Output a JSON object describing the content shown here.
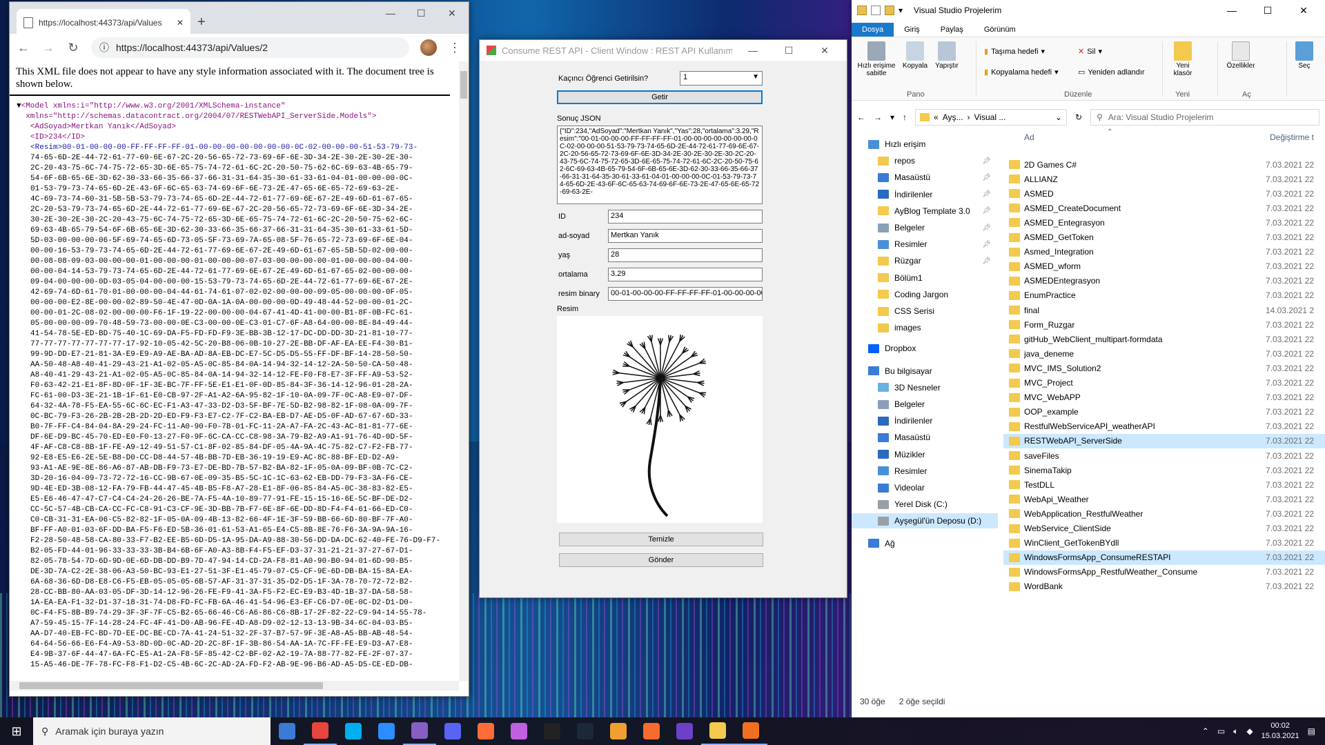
{
  "chrome": {
    "tab_title": "https://localhost:44373/api/Values",
    "url": "https://localhost:44373/api/Values/2",
    "xml_note": "This XML file does not appear to have any style information associated with it. The document tree is shown below.",
    "model_open_1": "<Model xmlns:i=\"http://www.w3.org/2001/XMLSchema-instance\"",
    "model_open_2": "xmlns=\"http://schemas.datacontract.org/2004/07/RESTWebAPI_ServerSide.Models\">",
    "adsoyad_line": "<AdSoyad>Mertkan Yanık</AdSoyad>",
    "id_line": "<ID>234</ID>",
    "resim_lines": [
      "<Resim>00-01-00-00-00-FF-FF-FF-FF-01-00-00-00-00-00-00-00-0C-02-00-00-00-51-53-79-73-",
      "74-65-6D-2E-44-72-61-77-69-6E-67-2C-20-56-65-72-73-69-6F-6E-3D-34-2E-30-2E-30-2E-30-",
      "2C-20-43-75-6C-74-75-72-65-3D-6E-65-75-74-72-61-6C-2C-20-50-75-62-6C-69-63-4B-65-79-",
      "54-6F-6B-65-6E-3D-62-30-33-66-35-66-37-66-31-31-64-35-30-61-33-61-04-01-00-00-00-0C-",
      "01-53-79-73-74-65-6D-2E-43-6F-6C-65-63-74-69-6F-6E-73-2E-47-65-6E-65-72-69-63-2E-",
      "4C-69-73-74-60-31-5B-5B-53-79-73-74-65-6D-2E-44-72-61-77-69-6E-67-2E-49-6D-61-67-65-",
      "2C-20-53-79-73-74-65-6D-2E-44-72-61-77-69-6E-67-2C-20-56-65-72-73-69-6F-6E-3D-34-2E-",
      "30-2E-30-2E-30-2C-20-43-75-6C-74-75-72-65-3D-6E-65-75-74-72-61-6C-2C-20-50-75-62-6C-",
      "69-63-4B-65-79-54-6F-6B-65-6E-3D-62-30-33-66-35-66-37-66-31-31-64-35-30-61-33-61-5D-",
      "5D-03-00-00-00-06-5F-69-74-65-6D-73-05-5F-73-69-7A-65-08-5F-76-65-72-73-69-6F-6E-04-",
      "00-00-16-53-79-73-74-65-6D-2E-44-72-61-77-69-6E-67-2E-49-6D-61-67-65-5B-5D-02-00-00-",
      "00-08-08-09-03-00-00-00-01-00-00-00-01-00-00-00-07-03-00-00-00-00-01-00-00-00-04-00-",
      "00-00-04-14-53-79-73-74-65-6D-2E-44-72-61-77-69-6E-67-2E-49-6D-61-67-65-02-00-00-00-",
      "09-04-00-00-00-0D-03-05-04-00-00-00-15-53-79-73-74-65-6D-2E-44-72-61-77-69-6E-67-2E-",
      "42-69-74-6D-61-70-01-00-00-00-04-44-61-74-61-07-02-02-00-00-00-09-05-00-00-00-0F-05-",
      "00-00-00-E2-8E-00-00-02-89-50-4E-47-0D-0A-1A-0A-00-00-00-0D-49-48-44-52-00-00-01-2C-",
      "00-00-01-2C-08-02-00-00-00-F6-1F-19-22-00-00-00-04-67-41-4D-41-00-00-B1-8F-0B-FC-61-",
      "05-00-00-00-09-70-48-59-73-00-00-0E-C3-00-00-0E-C3-01-C7-6F-A8-64-00-00-8E-84-49-44-",
      "41-54-78-5E-ED-BD-75-40-1C-69-DA-F5-FD-FD-F9-3E-BB-3B-12-17-DC-DD-DD-3D-21-81-10-77-",
      "77-77-77-77-77-77-77-17-92-10-05-42-5C-20-B8-06-0B-10-27-2E-BB-DF-AF-EA-EE-F4-30-B1-",
      "99-9D-DD-E7-21-81-3A-E9-E9-A9-AE-BA-AD-8A-EB-DC-E7-5C-D5-D5-55-FF-DF-BF-14-28-50-50-",
      "AA-50-48-A8-40-41-29-43-21-A1-02-05-A5-0C-85-84-0A-14-94-32-14-12-2A-50-50-CA-50-48-",
      "A8-40-41-29-43-21-A1-02-05-A5-0C-85-84-0A-14-94-32-14-12-FE-F0-F8-E7-3F-FF-A9-53-52-",
      "F0-63-42-21-E1-8F-8D-0F-1F-3E-BC-7F-FF-5E-E1-E1-0F-0D-85-84-3F-36-14-12-96-01-28-2A-",
      "FC-61-00-D3-3E-21-1B-1F-61-E0-CB-97-2F-A1-A2-6A-95-82-1F-10-0A-09-7F-0C-A8-E9-07-DF-",
      "64-32-4A-78-F5-EA-55-6C-6C-EC-F1-A3-47-33-D2-D3-5F-BF-7E-5D-B2-98-82-1F-08-0A-09-7F-",
      "0C-BC-79-F3-26-2B-2B-2B-2D-2D-ED-F9-F3-E7-C2-7F-C2-BA-EB-D7-AE-D5-0F-AD-67-67-6D-33-",
      "B0-7F-FF-C4-84-04-8A-29-24-FC-11-A0-90-F0-7B-01-FC-11-2A-A7-FA-2C-43-AC-81-81-77-6E-",
      "DF-6E-D9-BC-45-70-ED-E0-F0-13-27-F0-9F-6C-CA-CC-C8-98-3A-79-B2-A9-A1-91-76-4D-0D-5F-",
      "4F-AF-C8-C8-8B-1F-FE-A9-12-49-51-57-C1-8F-02-85-84-DF-05-4A-9A-4C-75-82-C7-F2-FB-77-",
      "92-E8-E5-E6-2E-5E-B8-D0-CC-D8-44-57-4B-BB-7D-EB-36-19-19-E9-AC-8C-88-BF-ED-D2-A9-",
      "93-A1-AE-9E-8E-86-A6-87-AB-DB-F9-73-E7-DE-BD-7B-57-B2-BA-82-1F-05-0A-09-BF-0B-7C-C2-",
      "3D-20-16-04-09-73-72-72-16-CC-9B-67-0E-09-35-B5-5C-1C-1C-63-62-EB-DD-79-F3-3A-F6-CE-",
      "9D-4E-ED-3B-08-12-FA-79-FB-44-47-45-4B-B5-F8-A7-28-E1-8F-06-85-84-A5-0C-38-83-82-E5-",
      "E5-E6-46-47-47-C7-C4-C4-24-26-26-BE-7A-F5-4A-10-89-77-91-FE-15-15-16-6E-5C-BF-DE-D2-",
      "CC-5C-57-4B-CB-CA-CC-FC-C8-91-C3-CF-9E-3D-BB-7B-F7-6E-8F-6E-DD-8D-F4-F4-61-66-ED-C0-",
      "C0-CB-31-31-EA-06-C5-82-82-1F-05-0A-09-4B-13-82-66-4F-1E-3F-59-BB-66-6D-80-BF-7F-A0-",
      "BF-FF-A0-01-03-6F-DD-BA-F5-F6-ED-5B-36-01-61-53-A1-65-E4-C5-8B-8E-76-F6-3A-9A-9A-16-",
      "F2-28-50-48-58-CA-80-33-F7-B2-EE-B5-6D-D5-1A-95-DA-A9-88-30-56-DD-DA-DC-62-40-FE-76-D9-F7-",
      "B2-05-FD-44-01-96-33-33-33-3B-B4-6B-6F-A0-A3-8B-F4-F5-EF-D3-37-31-21-21-37-27-67-D1-",
      "82-05-78-54-7D-6D-9D-0E-6D-DB-DD-B9-7D-47-94-14-CD-2A-F8-81-A0-90-B0-94-01-6D-90-B5-",
      "DE-3D-7A-C2-2E-38-06-A3-50-BC-93-E1-27-51-3F-E1-45-79-07-C5-CF-9E-6D-DB-BA-15-8A-EA-",
      "6A-68-36-6D-D8-E8-C6-F5-EB-05-05-05-6B-57-AF-31-37-31-35-D2-D5-1F-3A-78-70-72-72-B2-",
      "28-CC-BB-80-AA-03-05-DF-3D-14-12-96-26-FE-F9-41-3A-F5-F2-EC-E9-B3-4D-1B-37-DA-58-58-",
      "1A-EA-EA-F1-32-D1-37-18-31-74-D8-FD-FC-FB-6A-46-41-54-96-E3-EF-C6-D7-0E-0C-D2-D1-D0-",
      "0C-F4-F5-8B-B9-74-29-3F-3F-7F-C5-B2-65-66-46-C6-A6-86-C6-8B-17-2F-82-22-C9-94-14-55-78-",
      "A7-59-45-15-7F-14-28-24-FC-4F-41-D0-AB-96-FE-4D-A8-D9-02-12-13-13-9B-34-6C-04-03-B5-",
      "AA-D7-40-EB-FC-BD-7D-EE-DC-BE-CD-7A-41-24-51-32-2F-37-B7-57-9F-3E-A8-A5-BB-AB-48-54-",
      "64-64-56-66-E6-F4-A9-53-8D-0D-0C-AD-2D-2C-8F-1F-3B-86-54-AA-1A-7C-FF-FE-E9-D3-A7-E8-",
      "E4-9B-37-6F-44-47-6A-FC-E5-A1-2A-F8-5F-85-42-C2-BF-02-A2-19-7A-88-77-82-FE-2F-07-37-",
      "15-A5-46-DE-7F-78-FC-F8-F1-D2-C5-4B-6C-2C-AD-2A-FD-F2-AB-9E-96-B6-AD-A5-D5-CE-ED-DB-"
    ]
  },
  "winform": {
    "title": "Consume REST API - Client Window : REST API Kullanımı - Cli...",
    "label_select": "Kaçıncı Öğrenci Getirilsin?",
    "select_value": "1",
    "btn_get": "Getir",
    "label_json": "Sonuç JSON",
    "json_text": "{\"ID\":234,\"AdSoyad\":\"Mertkan Yanık\",\"Yas\":28,\"ortalama\":3.29,\"Resim\":\"00-01-00-00-00-FF-FF-FF-FF-01-00-00-00-00-00-00-00-0C-02-00-00-00-51-53-79-73-74-65-6D-2E-44-72-61-77-69-6E-67-2C-20-56-65-72-73-69-6F-6E-3D-34-2E-30-2E-30-2E-30-2C-20-43-75-6C-74-75-72-65-3D-6E-65-75-74-72-61-6C-2C-20-50-75-62-6C-69-63-4B-65-79-54-6F-6B-65-6E-3D-62-30-33-66-35-66-37-66-31-31-64-35-30-61-33-61-04-01-00-00-00-0C-01-53-79-73-74-65-6D-2E-43-6F-6C-65-63-74-69-6F-6E-73-2E-47-65-6E-65-72-69-63-2E-",
    "label_id": "ID",
    "id_value": "234",
    "label_name": "ad-soyad",
    "name_value": "Mertkan Yanık",
    "label_age": "yaş",
    "age_value": "28",
    "label_avg": "ortalama",
    "avg_value": "3.29",
    "label_binary": "resim binary",
    "binary_value": "00-01-00-00-00-FF-FF-FF-FF-01-00-00-00-00-00-0",
    "label_image": "Resim",
    "btn_clear": "Temizle",
    "btn_send": "Gönder"
  },
  "explorer": {
    "title": "Visual Studio Projelerim",
    "tabs": [
      "Dosya",
      "Giriş",
      "Paylaş",
      "Görünüm"
    ],
    "ribbon": {
      "pin": "Hızlı erişime sabitle",
      "copy": "Kopyala",
      "paste": "Yapıştır",
      "move_to": "Taşıma hedefi",
      "copy_to": "Kopyalama hedefi",
      "delete": "Sil",
      "rename": "Yeniden adlandır",
      "new_folder": "Yeni klasör",
      "properties": "Özellikler",
      "select": "Seç",
      "g_pano": "Pano",
      "g_duzenle": "Düzenle",
      "g_yeni": "Yeni",
      "g_ac": "Aç"
    },
    "breadcrumb_1": "Ayş...",
    "breadcrumb_2": "Visual ...",
    "search_placeholder": "Ara: Visual Studio Projelerim",
    "nav": [
      {
        "label": "Hızlı erişim",
        "kind": "star"
      },
      {
        "label": "repos",
        "kind": "folder",
        "pinned": true
      },
      {
        "label": "Masaüstü",
        "kind": "desktop",
        "pinned": true
      },
      {
        "label": "İndirilenler",
        "kind": "download",
        "pinned": true
      },
      {
        "label": "AyBlog Template 3.0",
        "kind": "folder",
        "pinned": true
      },
      {
        "label": "Belgeler",
        "kind": "doc",
        "pinned": true
      },
      {
        "label": "Resimler",
        "kind": "pic",
        "pinned": true
      },
      {
        "label": "Rüzgar",
        "kind": "folder",
        "pinned": true
      },
      {
        "label": "Bölüm1",
        "kind": "folder"
      },
      {
        "label": "Coding Jargon",
        "kind": "folder"
      },
      {
        "label": "CSS Serisi",
        "kind": "folder"
      },
      {
        "label": "images",
        "kind": "folder"
      },
      {
        "label": "Dropbox",
        "kind": "dropbox"
      },
      {
        "label": "Bu bilgisayar",
        "kind": "pc"
      },
      {
        "label": "3D Nesneler",
        "kind": "3d"
      },
      {
        "label": "Belgeler",
        "kind": "doc"
      },
      {
        "label": "İndirilenler",
        "kind": "download"
      },
      {
        "label": "Masaüstü",
        "kind": "desktop"
      },
      {
        "label": "Müzikler",
        "kind": "music"
      },
      {
        "label": "Resimler",
        "kind": "pic"
      },
      {
        "label": "Videolar",
        "kind": "video"
      },
      {
        "label": "Yerel Disk (C:)",
        "kind": "drive"
      },
      {
        "label": "Ayşegül'ün Deposu (D:)",
        "kind": "drive",
        "selected": true
      },
      {
        "label": "Ağ",
        "kind": "network"
      }
    ],
    "col_name": "Ad",
    "col_date": "Değiştirme t",
    "files": [
      {
        "name": "2D Games C#",
        "date": "7.03.2021 22"
      },
      {
        "name": "ALLIANZ",
        "date": "7.03.2021 22"
      },
      {
        "name": "ASMED",
        "date": "7.03.2021 22"
      },
      {
        "name": "ASMED_CreateDocument",
        "date": "7.03.2021 22"
      },
      {
        "name": "ASMED_Entegrasyon",
        "date": "7.03.2021 22"
      },
      {
        "name": "ASMED_GetToken",
        "date": "7.03.2021 22"
      },
      {
        "name": "Asmed_Integration",
        "date": "7.03.2021 22"
      },
      {
        "name": "ASMED_wform",
        "date": "7.03.2021 22"
      },
      {
        "name": "ASMEDEntegrasyon",
        "date": "7.03.2021 22"
      },
      {
        "name": "EnumPractice",
        "date": "7.03.2021 22"
      },
      {
        "name": "final",
        "date": "14.03.2021 2"
      },
      {
        "name": "Form_Ruzgar",
        "date": "7.03.2021 22"
      },
      {
        "name": "gitHub_WebClient_multipart-formdata",
        "date": "7.03.2021 22"
      },
      {
        "name": "java_deneme",
        "date": "7.03.2021 22"
      },
      {
        "name": "MVC_IMS_Solution2",
        "date": "7.03.2021 22"
      },
      {
        "name": "MVC_Project",
        "date": "7.03.2021 22"
      },
      {
        "name": "MVC_WebAPP",
        "date": "7.03.2021 22"
      },
      {
        "name": "OOP_example",
        "date": "7.03.2021 22"
      },
      {
        "name": "RestfulWebServiceAPI_weatherAPI",
        "date": "7.03.2021 22"
      },
      {
        "name": "RESTWebAPI_ServerSide",
        "date": "7.03.2021 22",
        "selected": true
      },
      {
        "name": "saveFiles",
        "date": "7.03.2021 22"
      },
      {
        "name": "SinemaTakip",
        "date": "7.03.2021 22"
      },
      {
        "name": "TestDLL",
        "date": "7.03.2021 22"
      },
      {
        "name": "WebApi_Weather",
        "date": "7.03.2021 22"
      },
      {
        "name": "WebApplication_RestfulWeather",
        "date": "7.03.2021 22"
      },
      {
        "name": "WebService_ClientSide",
        "date": "7.03.2021 22"
      },
      {
        "name": "WinClient_GetTokenBYdll",
        "date": "7.03.2021 22"
      },
      {
        "name": "WindowsFormsApp_ConsumeRESTAPI",
        "date": "7.03.2021 22",
        "selected": true
      },
      {
        "name": "WindowsFormsApp_RestfulWeather_Consume",
        "date": "7.03.2021 22"
      },
      {
        "name": "WordBank",
        "date": "7.03.2021 22"
      }
    ],
    "status_count": "30 öğe",
    "status_selected": "2 öğe seçildi"
  },
  "taskbar": {
    "search_placeholder": "Aramak için buraya yazın",
    "time": "00:02",
    "date": "15.03.2021",
    "apps": [
      {
        "name": "explorer-app",
        "color": "#3a7bd5"
      },
      {
        "name": "chrome-app",
        "color": "#e8453c",
        "open": true
      },
      {
        "name": "skype-app",
        "color": "#00aff0"
      },
      {
        "name": "zoom-app",
        "color": "#2d8cff"
      },
      {
        "name": "visual-studio-app",
        "color": "#865fc5",
        "open": true
      },
      {
        "name": "discord-app",
        "color": "#5865f2"
      },
      {
        "name": "postman-app",
        "color": "#ff6c37"
      },
      {
        "name": "paint-app",
        "color": "#c060e0"
      },
      {
        "name": "unreal-app",
        "color": "#222222"
      },
      {
        "name": "steam-app",
        "color": "#1b2838"
      },
      {
        "name": "video-app",
        "color": "#f0a030"
      },
      {
        "name": "origin-app",
        "color": "#f56c2d"
      },
      {
        "name": "github-app",
        "color": "#6e40c9"
      },
      {
        "name": "file-explorer-app",
        "color": "#f3c94e",
        "open": true
      },
      {
        "name": "winforms-app",
        "color": "#f07020",
        "open": true
      }
    ]
  }
}
